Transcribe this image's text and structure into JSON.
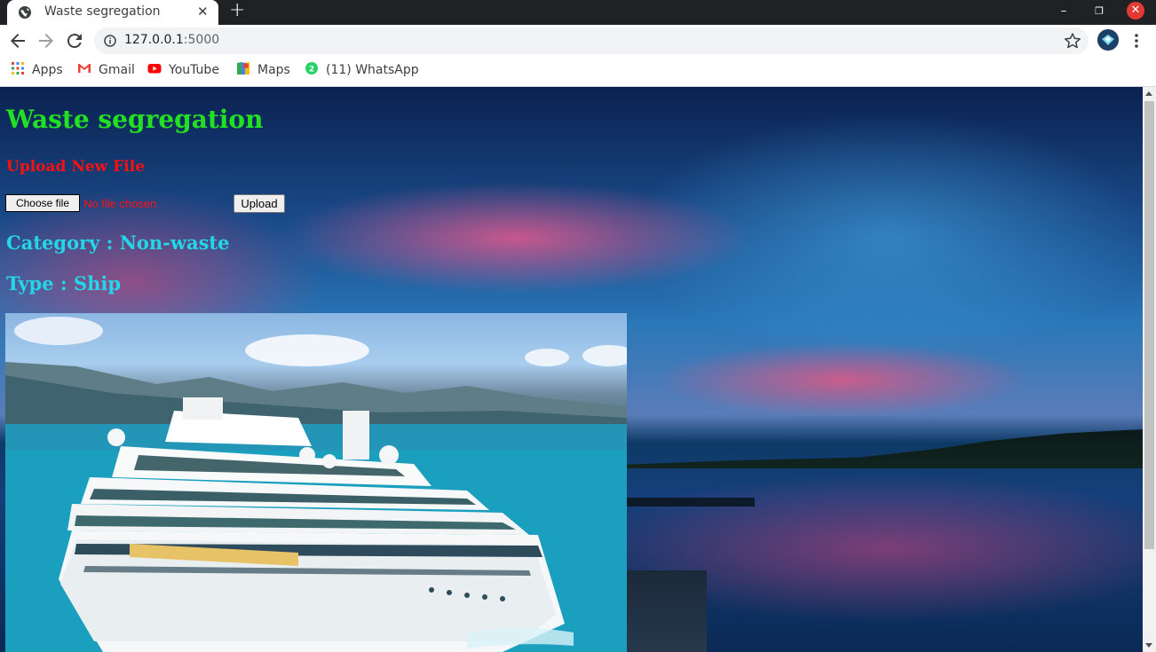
{
  "browser": {
    "tab_title": "Waste segregation",
    "tab_close_glyph": "✕",
    "new_tab_glyph": "+",
    "url_host": "127.0.0.1",
    "url_port": ":5000",
    "window_minimize_glyph": "–",
    "window_restore_glyph": "❐",
    "window_close_glyph": "✕"
  },
  "bookmarks": [
    {
      "label": "Apps",
      "icon": "apps-grid-icon"
    },
    {
      "label": "Gmail",
      "icon": "gmail-icon"
    },
    {
      "label": "YouTube",
      "icon": "youtube-icon"
    },
    {
      "label": "Maps",
      "icon": "maps-icon"
    },
    {
      "label": "(11) WhatsApp",
      "icon": "whatsapp-icon"
    }
  ],
  "page": {
    "title": "Waste segregation",
    "upload_heading": "Upload New File",
    "choose_file_label": "Choose file",
    "no_file_text": "No file chosen",
    "upload_button_label": "Upload",
    "category_text": "Category : Non-waste",
    "type_text": "Type : Ship"
  },
  "colors": {
    "title_green": "#22e022",
    "heading_red": "#ff1010",
    "result_cyan": "#23d6e8"
  }
}
